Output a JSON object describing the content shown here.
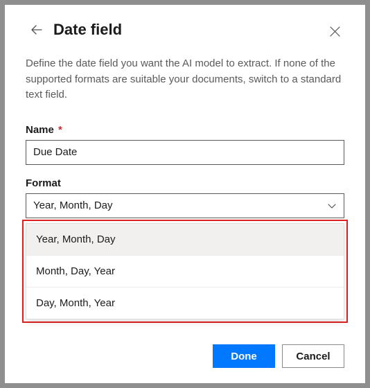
{
  "header": {
    "title": "Date field"
  },
  "description": "Define the date field you want the AI model to extract. If none of the supported formats are suitable your documents, switch to a standard text field.",
  "nameField": {
    "label": "Name",
    "required": "*",
    "value": "Due Date"
  },
  "formatField": {
    "label": "Format",
    "selected": "Year, Month, Day",
    "options": [
      "Year, Month, Day",
      "Month, Day, Year",
      "Day, Month, Year"
    ]
  },
  "footer": {
    "done": "Done",
    "cancel": "Cancel"
  }
}
